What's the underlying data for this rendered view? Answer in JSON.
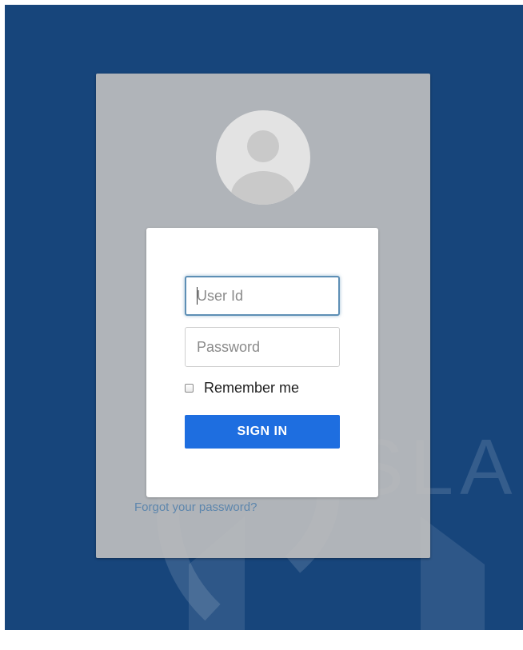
{
  "login": {
    "user_id_placeholder": "User Id",
    "password_placeholder": "Password",
    "remember_me_label": "Remember me",
    "remember_me_checked": false,
    "sign_in_label": "SIGN IN",
    "forgot_password_label": "Forgot your password?"
  },
  "watermark": {
    "text": "ISLA"
  },
  "icons": {
    "avatar": "user-avatar-icon",
    "checkbox": "checkbox-icon"
  },
  "colors": {
    "background": "#17457b",
    "panel": "#bebebe",
    "button": "#1e6ee0",
    "link": "#5d86ad",
    "focus_border": "#5e8fb5"
  }
}
